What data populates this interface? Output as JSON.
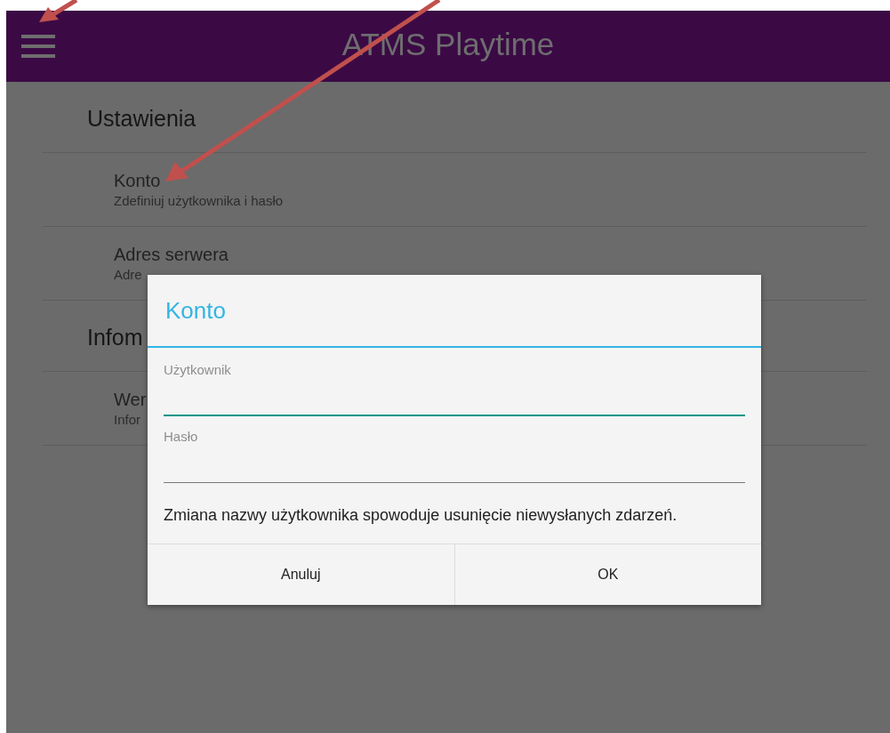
{
  "app_bar": {
    "title": "ATMS Playtime"
  },
  "settings": {
    "sections": [
      {
        "header": "Ustawienia",
        "items": [
          {
            "title": "Konto",
            "summary": "Zdefiniuj użytkownika i hasło"
          },
          {
            "title": "Adres serwera",
            "summary": "Adre"
          }
        ]
      },
      {
        "header": "Infom",
        "items": [
          {
            "title": "Wer",
            "summary": "Infor"
          }
        ]
      }
    ]
  },
  "dialog": {
    "title": "Konto",
    "fields": [
      {
        "label": "Użytkownik",
        "focused": true
      },
      {
        "label": "Hasło",
        "focused": false
      }
    ],
    "message": "Zmiana nazwy użytkownika spowoduje usunięcie niewysłanych zdarzeń.",
    "buttons": [
      "Anuluj",
      "OK"
    ]
  }
}
